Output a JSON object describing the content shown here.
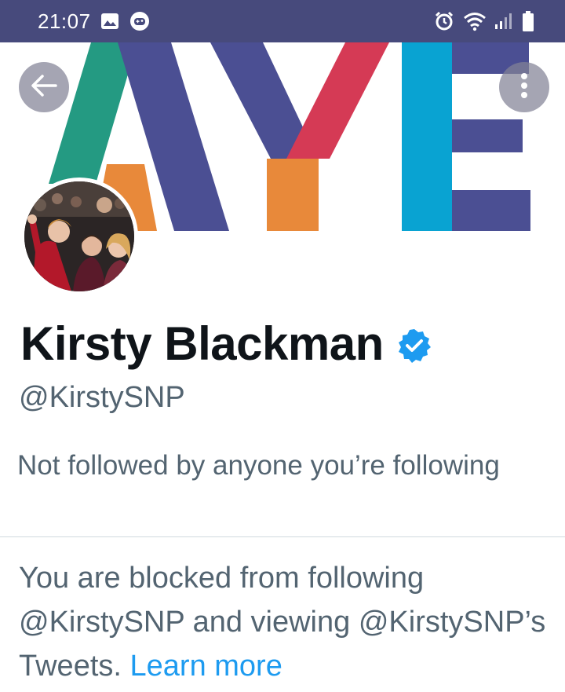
{
  "status_bar": {
    "time": "21:07",
    "left_icons": [
      "gallery-icon",
      "game-controller-icon"
    ],
    "right_icons": [
      "alarm-icon",
      "wifi-icon",
      "signal-icon",
      "battery-icon"
    ],
    "background": "#474a7c"
  },
  "banner": {
    "letters": [
      "A",
      "Y",
      "E"
    ],
    "colors": {
      "green": "#249a82",
      "purple": "#4b4f93",
      "orange": "#e8893a",
      "red": "#d53a55",
      "cyan": "#09a3d2"
    }
  },
  "toolbar": {
    "back_icon": "arrow-left-icon",
    "more_icon": "vertical-ellipsis-icon"
  },
  "profile": {
    "display_name": "Kirsty Blackman",
    "handle": "@KirstySNP",
    "verified": true,
    "verified_color": "#1d9bf0",
    "followers_note": "Not followed by anyone you’re following"
  },
  "blocked": {
    "message": "You are blocked from following @KirstySNP and viewing @KirstySNP’s Tweets.",
    "link_label": "Learn more",
    "link_color": "#1d9bf0"
  }
}
